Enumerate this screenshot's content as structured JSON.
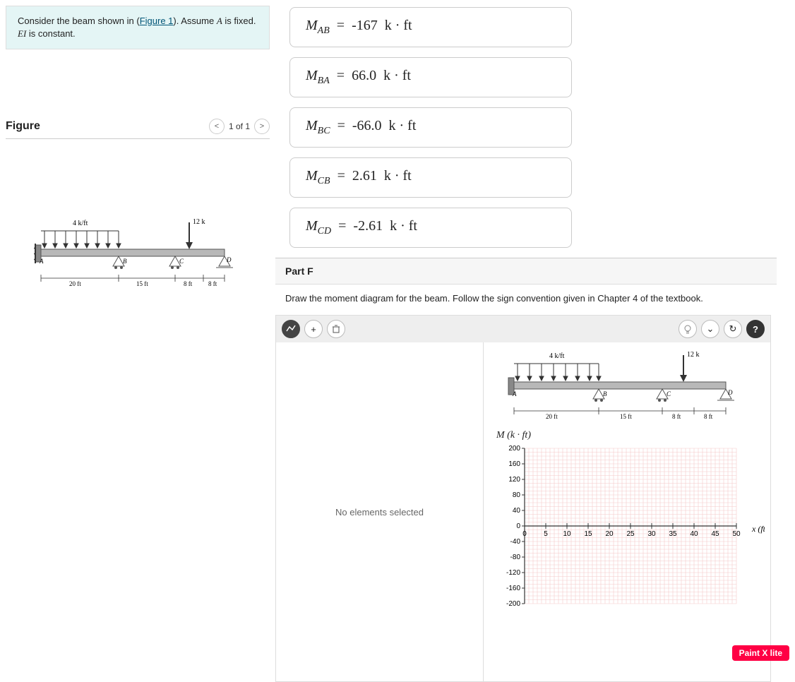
{
  "problem": {
    "text_before": "Consider the beam shown in (",
    "figure_link": "Figure 1",
    "text_after": "). Assume ",
    "var_A": "A",
    "text_after2": " is fixed. ",
    "var_EI": "EI",
    "text_after3": " is constant."
  },
  "figure": {
    "title": "Figure",
    "nav_text": "1 of 1",
    "prev": "<",
    "next": ">"
  },
  "beam": {
    "load_dist": "4 k/ft",
    "load_point": "12 k",
    "supports": [
      "A",
      "B",
      "C",
      "D"
    ],
    "span1": "20 ft",
    "span2": "15 ft",
    "span3": "8 ft",
    "span4": "8 ft"
  },
  "answers": [
    {
      "var": "M",
      "sub": "AB",
      "eq": "=",
      "val": "-167",
      "unit": "k · ft"
    },
    {
      "var": "M",
      "sub": "BA",
      "eq": "=",
      "val": "66.0",
      "unit": "k · ft"
    },
    {
      "var": "M",
      "sub": "BC",
      "eq": "=",
      "val": "-66.0",
      "unit": "k · ft"
    },
    {
      "var": "M",
      "sub": "CB",
      "eq": "=",
      "val": "2.61",
      "unit": "k · ft"
    },
    {
      "var": "M",
      "sub": "CD",
      "eq": "=",
      "val": "-2.61",
      "unit": "k · ft"
    }
  ],
  "part": {
    "label": "Part F",
    "instruction": "Draw the moment diagram for the beam. Follow the sign convention given in Chapter 4 of the textbook."
  },
  "drawing": {
    "no_selection": "No elements selected"
  },
  "chart_data": {
    "type": "line",
    "title": "M (k · ft)",
    "xlabel": "x (ft)",
    "ylabel": "M (k · ft)",
    "xlim": [
      0,
      50
    ],
    "ylim": [
      -200,
      200
    ],
    "xticks": [
      0,
      5,
      10,
      15,
      20,
      25,
      30,
      35,
      40,
      45,
      50
    ],
    "yticks": [
      -200,
      -160,
      -120,
      -80,
      -40,
      0,
      40,
      80,
      120,
      160,
      200
    ],
    "series": []
  },
  "paint_badge": "Paint X lite"
}
